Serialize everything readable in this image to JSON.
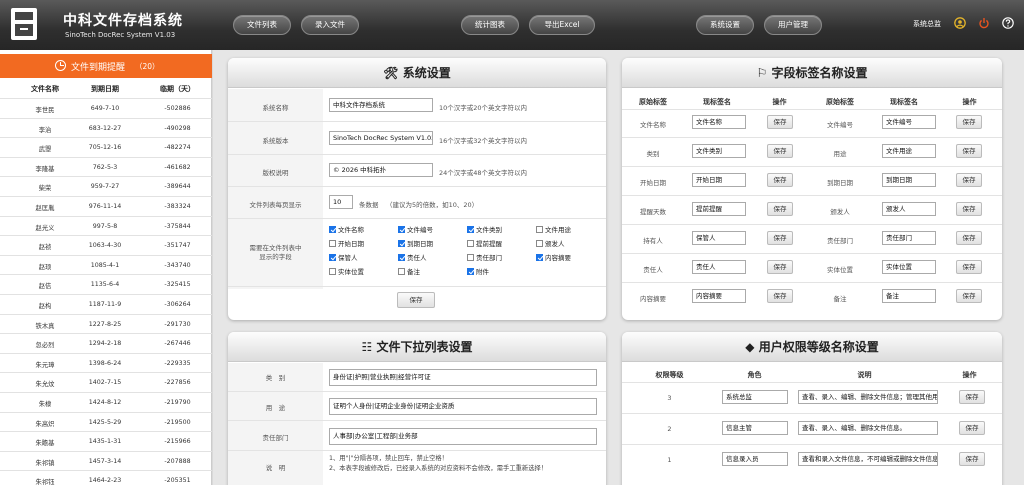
{
  "app": {
    "title": "中科文件存档系统",
    "subtitle": "SinoTech DocRec System V1.03"
  },
  "nav": {
    "file_list": "文件列表",
    "enter_file": "录入文件",
    "stats_chart": "统计图表",
    "export_excel": "导出Excel",
    "system_settings": "系统设置",
    "user_management": "用户管理"
  },
  "user": {
    "name": "系统总监"
  },
  "sidebar": {
    "title": "文件到期提醒",
    "count": "（20）",
    "columns": [
      "文件名称",
      "到期日期",
      "临期（天）"
    ],
    "rows": [
      [
        "李世民",
        "649-7-10",
        "-502886"
      ],
      [
        "李治",
        "683-12-27",
        "-490298"
      ],
      [
        "武曌",
        "705-12-16",
        "-482274"
      ],
      [
        "李隆基",
        "762-5-3",
        "-461682"
      ],
      [
        "柴荣",
        "959-7-27",
        "-389644"
      ],
      [
        "赵匡胤",
        "976-11-14",
        "-383324"
      ],
      [
        "赵光义",
        "997-5-8",
        "-375844"
      ],
      [
        "赵祯",
        "1063-4-30",
        "-351747"
      ],
      [
        "赵顼",
        "1085-4-1",
        "-343740"
      ],
      [
        "赵佶",
        "1135-6-4",
        "-325415"
      ],
      [
        "赵构",
        "1187-11-9",
        "-306264"
      ],
      [
        "铁木真",
        "1227-8-25",
        "-291730"
      ],
      [
        "忽必烈",
        "1294-2-18",
        "-267446"
      ],
      [
        "朱元璋",
        "1398-6-24",
        "-229335"
      ],
      [
        "朱允炆",
        "1402-7-15",
        "-227856"
      ],
      [
        "朱棣",
        "1424-8-12",
        "-219790"
      ],
      [
        "朱高炽",
        "1425-5-29",
        "-219500"
      ],
      [
        "朱瞻基",
        "1435-1-31",
        "-215966"
      ],
      [
        "朱祁镇",
        "1457-3-14",
        "-207888"
      ],
      [
        "朱祁钰",
        "1464-2-23",
        "-205351"
      ]
    ]
  },
  "sys": {
    "title": "系统设置",
    "name_label": "系统名称",
    "name_value": "中科文件存档系统",
    "name_hint": "10个汉字或20个英文字符以内",
    "version_label": "系统版本",
    "version_value": "SinoTech DocRec System V1.03",
    "version_hint": "16个汉字或32个英文字符以内",
    "copyright_label": "版权说明",
    "copyright_value": "© 2026 中科拓扑",
    "copyright_hint": "24个汉字或48个英文字符以内",
    "perpage_label": "文件列表每页显示",
    "perpage_value": "10",
    "perpage_unit": "条数据",
    "perpage_hint": "（建议为5的倍数，如10、20）",
    "fields_label_1": "需要在文件列表中",
    "fields_label_2": "显示的字段",
    "fields": [
      {
        "label": "文件名称",
        "checked": true
      },
      {
        "label": "文件编号",
        "checked": true
      },
      {
        "label": "文件类别",
        "checked": true
      },
      {
        "label": "文件用途",
        "checked": false
      },
      {
        "label": "开始日期",
        "checked": false
      },
      {
        "label": "到期日期",
        "checked": true
      },
      {
        "label": "提前提醒",
        "checked": false
      },
      {
        "label": "颁发人",
        "checked": false
      },
      {
        "label": "保管人",
        "checked": true
      },
      {
        "label": "责任人",
        "checked": true
      },
      {
        "label": "责任部门",
        "checked": false
      },
      {
        "label": "内容摘要",
        "checked": true
      },
      {
        "label": "实体位置",
        "checked": false
      },
      {
        "label": "备注",
        "checked": false
      },
      {
        "label": "附件",
        "checked": true
      }
    ],
    "save": "保存"
  },
  "labels": {
    "title": "字段标签名称设置",
    "headers": [
      "原始标签",
      "现标签名",
      "操作",
      "原始标签",
      "现标签名",
      "操作"
    ],
    "save": "保存",
    "rows": [
      [
        "文件名称",
        "文件名称",
        "文件编号",
        "文件编号"
      ],
      [
        "类别",
        "文件类别",
        "用途",
        "文件用途"
      ],
      [
        "开始日期",
        "开始日期",
        "到期日期",
        "到期日期"
      ],
      [
        "提醒天数",
        "提前提醒",
        "颁发人",
        "颁发人"
      ],
      [
        "持有人",
        "保管人",
        "责任部门",
        "责任部门"
      ],
      [
        "责任人",
        "责任人",
        "实体位置",
        "实体位置"
      ],
      [
        "内容摘要",
        "内容摘要",
        "备注",
        "备注"
      ]
    ]
  },
  "dropdown": {
    "title": "文件下拉列表设置",
    "category_label": "类　别",
    "category_value": "身份证|护照|营业执照|经营许可证",
    "usage_label": "用　途",
    "usage_value": "证明个人身份|证明企业身份|证明企业资质",
    "dept_label": "责任部门",
    "dept_value": "人事部|办公室|工程部|业务部",
    "desc_label": "说　明",
    "desc_line1": "1、用\"|\"分隔各项，禁止回车，禁止空格！",
    "desc_line2": "2、本表字段被修改后，已经录入系统的对应资料不会修改，需手工重新选择！"
  },
  "perm": {
    "title": "用户权限等级名称设置",
    "headers": [
      "权限等级",
      "角色",
      "说明",
      "操作"
    ],
    "save": "保存",
    "rows": [
      [
        "3",
        "系统总监",
        "查看、录入、编辑、删除文件信息；管理其他用户"
      ],
      [
        "2",
        "信息主管",
        "查看、录入、编辑、删除文件信息。"
      ],
      [
        "1",
        "信息录入员",
        "查看和录入文件信息，不可编辑或删除文件信息。"
      ]
    ]
  },
  "colors": {
    "accent": "#f26a21",
    "checkbox": "#1a73e8"
  }
}
